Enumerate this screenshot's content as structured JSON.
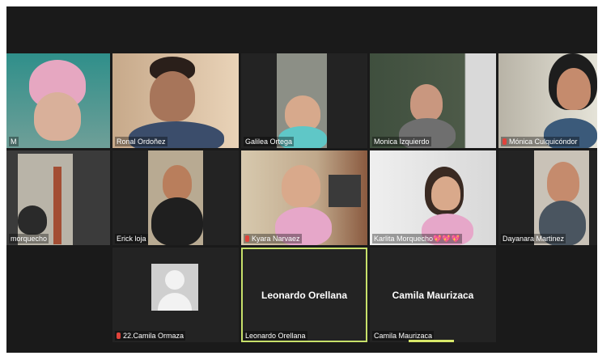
{
  "participants": [
    {
      "name": "M",
      "muted": false
    },
    {
      "name": "Ronal Ordoñez",
      "muted": false
    },
    {
      "name": "Galilea Ortega",
      "muted": false
    },
    {
      "name": "Monica Izquierdo",
      "muted": false
    },
    {
      "name": "Mónica Culquicóndor",
      "muted": true
    },
    {
      "name": "morquecho",
      "muted": false
    },
    {
      "name": "Erick loja",
      "muted": false
    },
    {
      "name": "Kyara Narvaez",
      "muted": true
    },
    {
      "name": "Karlita Morquecho💖💖💖",
      "muted": false
    },
    {
      "name": "Dayanara Martinez",
      "muted": false
    },
    {
      "name": "22.Camila Ormaza",
      "muted": true
    },
    {
      "name": "Leonardo Orellana",
      "muted": false
    },
    {
      "name": "Camila Maurizaca",
      "muted": false
    }
  ],
  "center_names": {
    "leonardo": "Leonardo Orellana",
    "camila": "Camila Maurizaca"
  },
  "colors": {
    "active_speaker": "#c7e06a",
    "muted_mic": "#e0433b"
  }
}
